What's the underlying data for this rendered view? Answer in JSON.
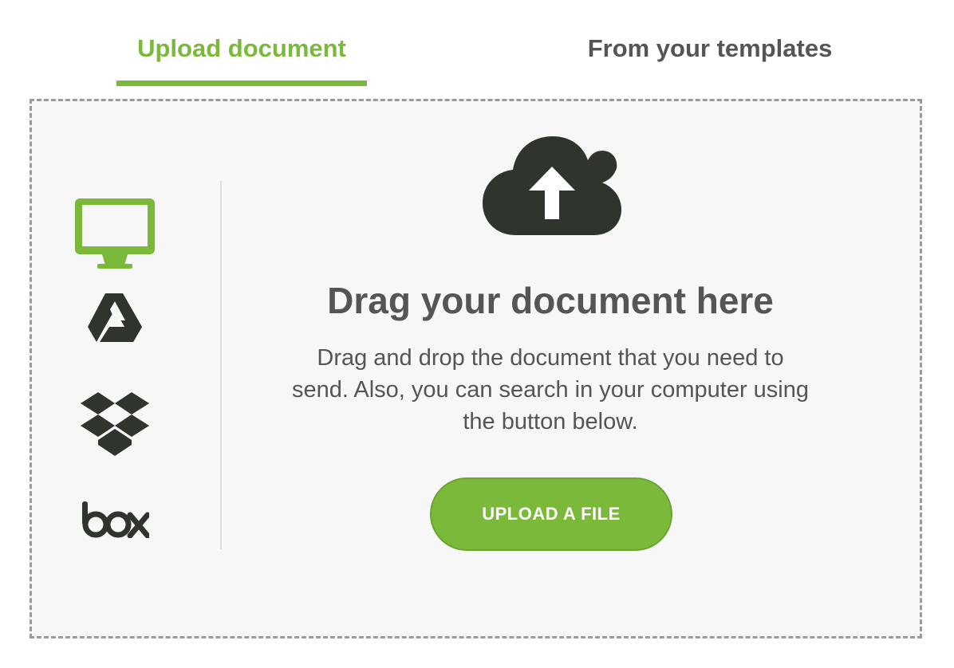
{
  "colors": {
    "accent": "#7ab93a",
    "dark_icon": "#2f352d",
    "text": "#555555"
  },
  "tabs": [
    {
      "label": "Upload document",
      "active": true
    },
    {
      "label": "From your templates",
      "active": false
    }
  ],
  "sources": [
    {
      "icon": "computer-icon",
      "active": true
    },
    {
      "icon": "google-drive-icon",
      "active": false
    },
    {
      "icon": "dropbox-icon",
      "active": false
    },
    {
      "icon": "box-icon",
      "active": false
    }
  ],
  "main": {
    "icon": "cloud-upload-icon",
    "headline": "Drag your document here",
    "description": "Drag and drop the document that you need to send. Also, you can search in your computer using the button below.",
    "button_label": "UPLOAD A FILE"
  }
}
